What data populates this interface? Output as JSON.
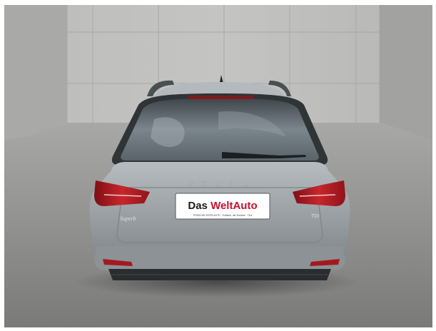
{
  "photo": {
    "subject": "car-rear-view",
    "colors": {
      "wall": "#b6b6b4",
      "floor": "#8e8e8e",
      "car_body": "#9da3a6",
      "tail_light": "#b11e24",
      "brand_red": "#c8102e"
    },
    "badge_text": "SKODA",
    "model_text": "Superb",
    "trim_text": "TDI",
    "plate": {
      "text_part1": "Das ",
      "text_part2": "WeltAuto",
      "dealer_text": "PORSCHE INTER AUTO · Kufstein, die Zentrale · Tirol"
    }
  }
}
